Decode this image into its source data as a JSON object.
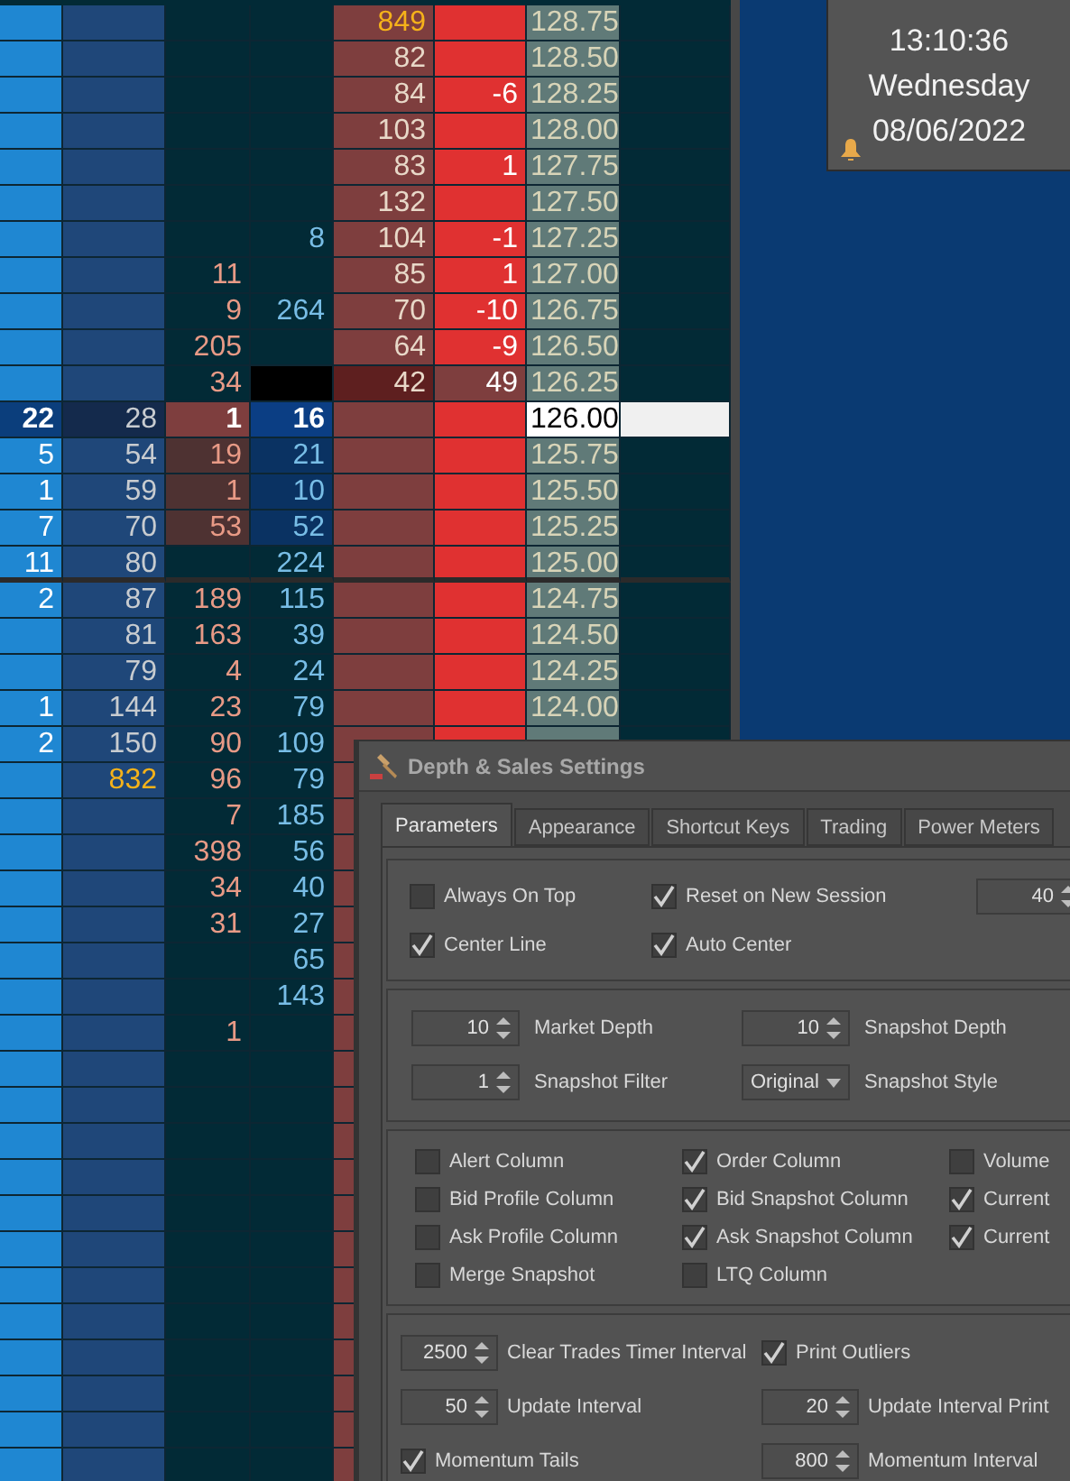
{
  "ladder": {
    "rows": [
      {
        "cells": [
          "",
          "",
          "",
          "",
          {
            "text": "849",
            "alert": true
          },
          "",
          "128.75",
          ""
        ],
        "kind": "normal",
        "divider_below": false
      },
      {
        "cells": [
          "",
          "",
          "",
          "",
          "82",
          "",
          "128.50",
          ""
        ],
        "kind": "normal",
        "divider_below": false
      },
      {
        "cells": [
          "",
          "",
          "",
          "",
          "84",
          "-6",
          "128.25",
          ""
        ],
        "kind": "normal",
        "divider_below": false
      },
      {
        "cells": [
          "",
          "",
          "",
          "",
          "103",
          "",
          "128.00",
          ""
        ],
        "kind": "normal",
        "divider_below": false
      },
      {
        "cells": [
          "",
          "",
          "",
          "",
          "83",
          "1",
          "127.75",
          ""
        ],
        "kind": "normal",
        "divider_below": false
      },
      {
        "cells": [
          "",
          "",
          "",
          "",
          "132",
          "",
          "127.50",
          ""
        ],
        "kind": "normal",
        "divider_below": false
      },
      {
        "cells": [
          "",
          "",
          "",
          "8",
          "104",
          "-1",
          "127.25",
          ""
        ],
        "kind": "normal",
        "divider_below": false
      },
      {
        "cells": [
          "",
          "",
          "11",
          "",
          "85",
          "1",
          "127.00",
          ""
        ],
        "kind": "normal",
        "divider_below": false
      },
      {
        "cells": [
          "",
          "",
          "9",
          "264",
          "70",
          "-10",
          "126.75",
          ""
        ],
        "kind": "normal",
        "divider_below": false
      },
      {
        "cells": [
          "",
          "",
          "205",
          "",
          "64",
          "-9",
          "126.50",
          ""
        ],
        "kind": "normal",
        "divider_below": false
      },
      {
        "cells": [
          "",
          "",
          "34",
          "",
          "42",
          "49",
          "126.25",
          ""
        ],
        "kind": "trade",
        "divider_below": false
      },
      {
        "cells": [
          "22",
          "28",
          "1",
          "16",
          "",
          "",
          "126.00",
          ""
        ],
        "kind": "current",
        "divider_below": false
      },
      {
        "cells": [
          "5",
          "54",
          "19",
          "21",
          "",
          "",
          "125.75",
          ""
        ],
        "kind": "recent",
        "divider_below": false
      },
      {
        "cells": [
          "1",
          "59",
          "1",
          "10",
          "",
          "",
          "125.50",
          ""
        ],
        "kind": "recent",
        "divider_below": false
      },
      {
        "cells": [
          "7",
          "70",
          "53",
          "52",
          "",
          "",
          "125.25",
          ""
        ],
        "kind": "recent",
        "divider_below": false
      },
      {
        "cells": [
          "11",
          "80",
          "",
          "224",
          "",
          "",
          "125.00",
          ""
        ],
        "kind": "normal",
        "divider_below": true
      },
      {
        "cells": [
          "2",
          "87",
          "189",
          "115",
          "",
          "",
          "124.75",
          ""
        ],
        "kind": "normal",
        "divider_below": false
      },
      {
        "cells": [
          "",
          "81",
          "163",
          "39",
          "",
          "",
          "124.50",
          ""
        ],
        "kind": "normal",
        "divider_below": false
      },
      {
        "cells": [
          "",
          "79",
          "4",
          "24",
          "",
          "",
          "124.25",
          ""
        ],
        "kind": "normal",
        "divider_below": false
      },
      {
        "cells": [
          "1",
          "144",
          "23",
          "79",
          "",
          "",
          "124.00",
          ""
        ],
        "kind": "normal",
        "divider_below": false
      },
      {
        "cells": [
          "2",
          "150",
          "90",
          "109",
          "",
          "",
          "",
          ""
        ],
        "kind": "normal",
        "divider_below": false
      },
      {
        "cells": [
          "",
          {
            "text": "832",
            "alert": true
          },
          "96",
          "79",
          ""
        ],
        "kind": "normal",
        "divider_below": false
      },
      {
        "cells": [
          "",
          "",
          "7",
          "185",
          ""
        ],
        "kind": "normal",
        "divider_below": false
      },
      {
        "cells": [
          "",
          "",
          "398",
          "56",
          ""
        ],
        "kind": "normal",
        "divider_below": false
      },
      {
        "cells": [
          "",
          "",
          "34",
          "40",
          ""
        ],
        "kind": "normal",
        "divider_below": false
      },
      {
        "cells": [
          "",
          "",
          "31",
          "27",
          ""
        ],
        "kind": "normal",
        "divider_below": false
      },
      {
        "cells": [
          "",
          "",
          "",
          "65",
          ""
        ],
        "kind": "normal",
        "divider_below": false
      },
      {
        "cells": [
          "",
          "",
          "",
          "143",
          ""
        ],
        "kind": "normal",
        "divider_below": false
      },
      {
        "cells": [
          "",
          "",
          "1",
          "",
          ""
        ],
        "kind": "normal",
        "divider_below": false
      },
      {
        "cells": [
          "",
          "",
          "",
          "",
          ""
        ],
        "kind": "normal",
        "divider_below": false
      },
      {
        "cells": [
          "",
          "",
          "",
          "",
          ""
        ],
        "kind": "normal",
        "divider_below": false
      },
      {
        "cells": [
          "",
          "",
          "",
          "",
          ""
        ],
        "kind": "normal",
        "divider_below": false
      },
      {
        "cells": [
          "",
          "",
          "",
          "",
          ""
        ],
        "kind": "normal",
        "divider_below": false
      },
      {
        "cells": [
          "",
          "",
          "",
          "",
          ""
        ],
        "kind": "normal",
        "divider_below": false
      },
      {
        "cells": [
          "",
          "",
          "",
          "",
          ""
        ],
        "kind": "normal",
        "divider_below": false
      },
      {
        "cells": [
          "",
          "",
          "",
          "",
          ""
        ],
        "kind": "normal",
        "divider_below": false
      },
      {
        "cells": [
          "",
          "",
          "",
          "",
          ""
        ],
        "kind": "normal",
        "divider_below": false
      },
      {
        "cells": [
          "",
          "",
          "",
          "",
          ""
        ],
        "kind": "normal",
        "divider_below": false
      },
      {
        "cells": [
          "",
          "",
          "",
          "",
          ""
        ],
        "kind": "normal",
        "divider_below": false
      },
      {
        "cells": [
          "",
          "",
          "",
          "",
          ""
        ],
        "kind": "normal",
        "divider_below": false
      },
      {
        "cells": [
          "",
          "",
          "",
          "",
          ""
        ],
        "kind": "normal",
        "divider_below": false
      }
    ]
  },
  "clock": {
    "time": "13:10:36",
    "day": "Wednesday",
    "date": "08/06/2022"
  },
  "dialog": {
    "title": "Depth & Sales Settings",
    "tabs": [
      {
        "label": "Parameters",
        "selected": true
      },
      {
        "label": "Appearance",
        "selected": false
      },
      {
        "label": "Shortcut Keys",
        "selected": false
      },
      {
        "label": "Trading",
        "selected": false
      },
      {
        "label": "Power Meters",
        "selected": false
      }
    ],
    "general": {
      "checkboxes": [
        {
          "label": "Always On Top",
          "checked": false
        },
        {
          "label": "Reset on New Session",
          "checked": true
        },
        {
          "label": "Center Line",
          "checked": true
        },
        {
          "label": "Auto Center",
          "checked": true
        }
      ],
      "spinner": {
        "value": "40"
      }
    },
    "depth": {
      "items": [
        {
          "kind": "spinner",
          "value": "10",
          "label": "Market Depth"
        },
        {
          "kind": "spinner",
          "value": "10",
          "label": "Snapshot Depth"
        },
        {
          "kind": "spinner",
          "value": "1",
          "label": "Snapshot Filter"
        },
        {
          "kind": "dropdown",
          "value": "Original",
          "label": "Snapshot Style"
        }
      ]
    },
    "columns": {
      "checkboxes": [
        {
          "label": "Alert Column",
          "checked": false
        },
        {
          "label": "Order Column",
          "checked": true
        },
        {
          "label": "Volume",
          "checked": false
        },
        {
          "label": "Bid Profile Column",
          "checked": false
        },
        {
          "label": "Bid Snapshot Column",
          "checked": true
        },
        {
          "label": "Current",
          "checked": true
        },
        {
          "label": "Ask Profile Column",
          "checked": false
        },
        {
          "label": "Ask Snapshot Column",
          "checked": true
        },
        {
          "label": "Current",
          "checked": true
        },
        {
          "label": "Merge Snapshot",
          "checked": false
        },
        {
          "label": "LTQ Column",
          "checked": false
        }
      ]
    },
    "timing": {
      "items": [
        {
          "kind": "spinner",
          "value": "2500",
          "label": "Clear Trades Timer Interval"
        },
        {
          "kind": "checkbox",
          "checked": true,
          "label": "Print Outliers"
        },
        {
          "kind": "spinner",
          "value": "50",
          "label": "Update Interval"
        },
        {
          "kind": "spinner",
          "value": "20",
          "label": "Update Interval Print"
        },
        {
          "kind": "checkbox",
          "checked": true,
          "label": "Momentum Tails"
        },
        {
          "kind": "spinner",
          "value": "800",
          "label": "Momentum Interval"
        }
      ]
    }
  }
}
